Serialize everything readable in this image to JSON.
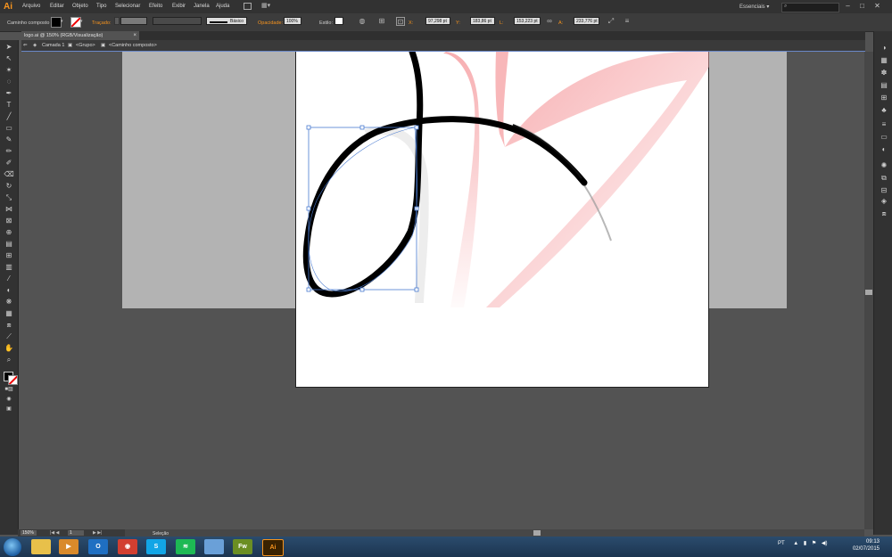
{
  "app": {
    "logo": "Ai",
    "workspace": "Essenciais ▾"
  },
  "menu": [
    "Arquivo",
    "Editar",
    "Objeto",
    "Tipo",
    "Selecionar",
    "Efeito",
    "Exibir",
    "Janela",
    "Ajuda"
  ],
  "controlbar": {
    "object_type": "Caminho composto",
    "stroke_label": "Traçado:",
    "brush_label": "Básico",
    "opacity_label": "Opacidade:",
    "opacity_value": "100%",
    "style_label": "Estilo:",
    "x_label": "X:",
    "x_value": "97,298 pt",
    "y_label": "Y:",
    "y_value": "183,86 pt",
    "w_label": "L:",
    "w_value": "153,223 pt",
    "h_label": "A:",
    "h_value": "233,776 pt"
  },
  "tab": {
    "title": "logo.ai @ 150% (RGB/Visualização)",
    "close": "×"
  },
  "breadcrumb": {
    "layer": "Camada 1",
    "group": "<Grupo>",
    "path": "<Caminho composto>"
  },
  "status": {
    "zoom": "150%",
    "page": "1",
    "tool": "Seleção"
  },
  "taskbar": {
    "apps": [
      {
        "name": "explorer-icon",
        "label": "",
        "color": "#e8c04a"
      },
      {
        "name": "media-player-icon",
        "label": "▶",
        "color": "#d98a2b"
      },
      {
        "name": "outlook-icon",
        "label": "O",
        "color": "#1f6fc2"
      },
      {
        "name": "chrome-icon",
        "label": "◉",
        "color": "#d23f31"
      },
      {
        "name": "skype-icon",
        "label": "S",
        "color": "#12a5e6"
      },
      {
        "name": "spotify-icon",
        "label": "≋",
        "color": "#1db954"
      },
      {
        "name": "app-icon",
        "label": "",
        "color": "#6aa0d8"
      },
      {
        "name": "fireworks-icon",
        "label": "Fw",
        "color": "#6b8e23"
      },
      {
        "name": "illustrator-icon",
        "label": "Ai",
        "color": "#3a2200"
      }
    ],
    "lang": "PT",
    "time": "09:13",
    "date": "02/07/2015"
  },
  "colors": {
    "accent": "#f7941e",
    "selection": "#4a7bd0",
    "artwork_pink": "#f6a5a8"
  }
}
